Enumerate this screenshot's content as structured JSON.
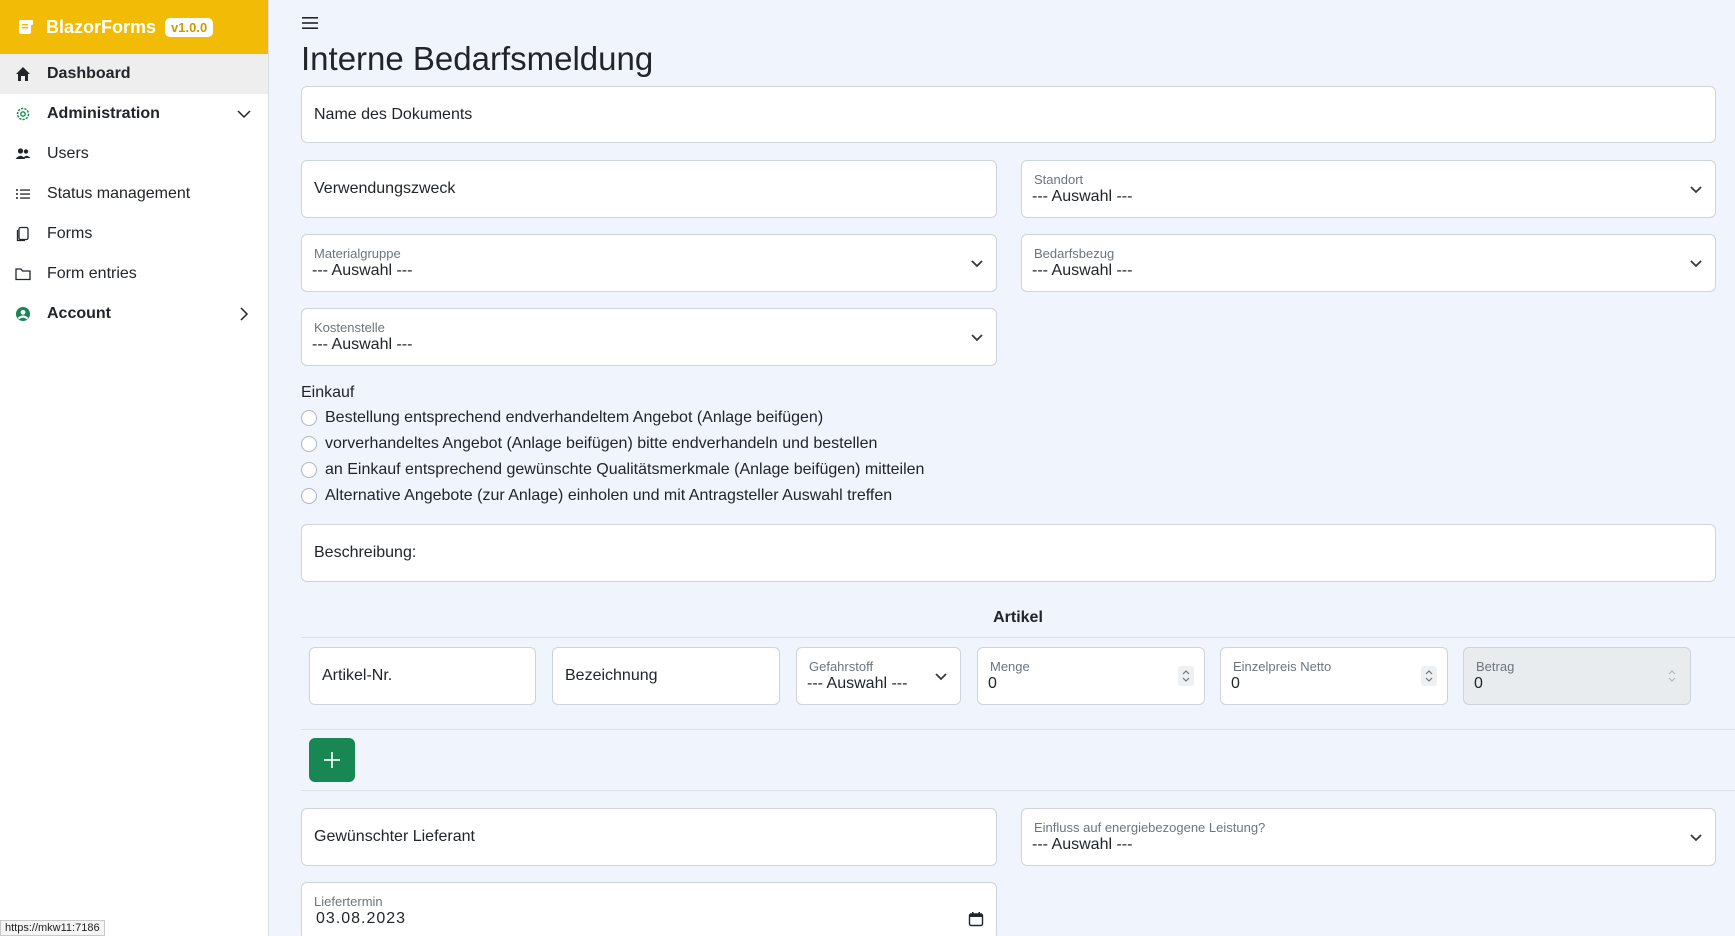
{
  "app": {
    "name": "BlazorForms",
    "version": "v1.0.0"
  },
  "sidebar": {
    "items": [
      {
        "label": "Dashboard",
        "icon": "home-icon"
      },
      {
        "label": "Administration",
        "icon": "gear-icon"
      },
      {
        "label": "Users",
        "icon": "users-icon"
      },
      {
        "label": "Status management",
        "icon": "list-icon"
      },
      {
        "label": "Forms",
        "icon": "copy-icon"
      },
      {
        "label": "Form entries",
        "icon": "folder-icon"
      },
      {
        "label": "Account",
        "icon": "user-circle-icon"
      }
    ]
  },
  "page": {
    "title": "Interne Bedarfsmeldung"
  },
  "form": {
    "name_placeholder": "Name des Dokuments",
    "verwendungszweck_placeholder": "Verwendungszweck",
    "standort": {
      "label": "Standort",
      "value": "--- Auswahl ---"
    },
    "materialgruppe": {
      "label": "Materialgruppe",
      "value": "--- Auswahl ---"
    },
    "bedarfsbezug": {
      "label": "Bedarfsbezug",
      "value": "--- Auswahl ---"
    },
    "kostenstelle": {
      "label": "Kostenstelle",
      "value": "--- Auswahl ---"
    },
    "einkauf": {
      "label": "Einkauf",
      "options": [
        "Bestellung entsprechend endverhandeltem Angebot (Anlage beifügen)",
        "vorverhandeltes Angebot (Anlage beifügen) bitte endverhandeln und bestellen",
        "an Einkauf entsprechend gewünschte Qualitätsmerkmale (Anlage beifügen) mitteilen",
        "Alternative Angebote (zur Anlage) einholen und mit Antragsteller Auswahl treffen"
      ]
    },
    "beschreibung_placeholder": "Beschreibung:",
    "artikel": {
      "title": "Artikel",
      "artikel_nr_placeholder": "Artikel-Nr.",
      "bezeichnung_placeholder": "Bezeichnung",
      "gefahrstoff": {
        "label": "Gefahrstoff",
        "value": "--- Auswahl ---"
      },
      "menge": {
        "label": "Menge",
        "value": "0"
      },
      "einzelpreis": {
        "label": "Einzelpreis Netto",
        "value": "0"
      },
      "betrag": {
        "label": "Betrag",
        "value": "0"
      }
    },
    "lieferant_placeholder": "Gewünschter Lieferant",
    "einfluss": {
      "label": "Einfluss auf energiebezogene Leistung?",
      "value": "--- Auswahl ---"
    },
    "liefertermin": {
      "label": "Liefertermin",
      "value": "03.08.2023"
    }
  },
  "statusbar": {
    "url": "https://mkw11:7186"
  },
  "colors": {
    "brand": "#f2bb05",
    "add_button": "#198754",
    "page_bg": "#f0f4fc"
  }
}
